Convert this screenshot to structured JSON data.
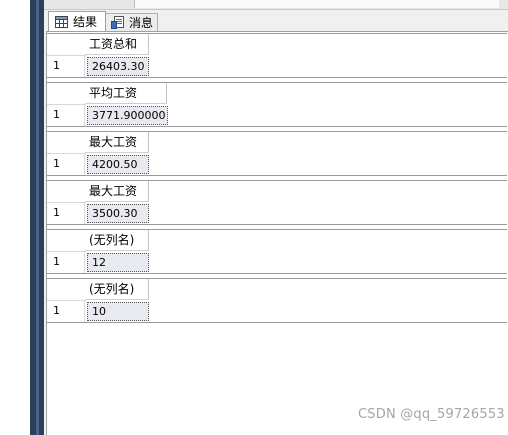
{
  "tabs": {
    "results_label": "结果",
    "messages_label": "消息",
    "results_icon": "grid-icon",
    "messages_icon": "message-doc-icon"
  },
  "result_sets": [
    {
      "column": "工资总和",
      "row_number": "1",
      "value": "26403.30"
    },
    {
      "column": "平均工资",
      "row_number": "1",
      "value": "3771.900000"
    },
    {
      "column": "最大工资",
      "row_number": "1",
      "value": "4200.50"
    },
    {
      "column": "最大工资",
      "row_number": "1",
      "value": "3500.30"
    },
    {
      "column": "(无列名)",
      "row_number": "1",
      "value": "12"
    },
    {
      "column": "(无列名)",
      "row_number": "1",
      "value": "10"
    }
  ],
  "watermark": "CSDN @qq_59726553",
  "colors": {
    "frame": "#2c3f5c",
    "selected_cell": "#e8eaf0"
  }
}
